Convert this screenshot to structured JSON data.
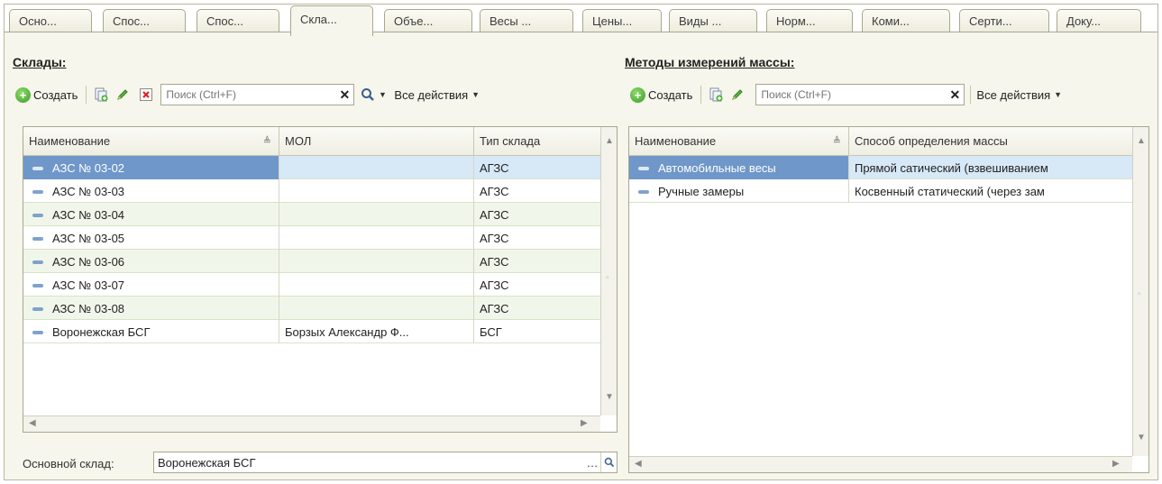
{
  "tabs": [
    {
      "label": "Осно..."
    },
    {
      "label": "Спос..."
    },
    {
      "label": "Спос..."
    },
    {
      "label": "Скла..."
    },
    {
      "label": "Объе..."
    },
    {
      "label": "Весы ..."
    },
    {
      "label": "Цены..."
    },
    {
      "label": "Виды ..."
    },
    {
      "label": "Норм..."
    },
    {
      "label": "Коми..."
    },
    {
      "label": "Серти..."
    },
    {
      "label": "Доку..."
    }
  ],
  "warehouses": {
    "title": "Склады:",
    "create_label": "Создать",
    "search_placeholder": "Поиск (Ctrl+F)",
    "all_actions_label": "Все действия",
    "columns": [
      "Наименование",
      "МОЛ",
      "Тип склада"
    ],
    "rows": [
      {
        "name": "АЗС № 03-02",
        "mol": "",
        "type": "АГЗС"
      },
      {
        "name": "АЗС № 03-03",
        "mol": "",
        "type": "АГЗС"
      },
      {
        "name": "АЗС № 03-04",
        "mol": "",
        "type": "АГЗС"
      },
      {
        "name": "АЗС № 03-05",
        "mol": "",
        "type": "АГЗС"
      },
      {
        "name": "АЗС № 03-06",
        "mol": "",
        "type": "АГЗС"
      },
      {
        "name": "АЗС № 03-07",
        "mol": "",
        "type": "АГЗС"
      },
      {
        "name": "АЗС № 03-08",
        "mol": "",
        "type": "АГЗС"
      },
      {
        "name": "Воронежская БСГ",
        "mol": "Борзых Александр Ф...",
        "type": "БСГ"
      }
    ],
    "main_label": "Основной склад:",
    "main_value": "Воронежская БСГ"
  },
  "methods": {
    "title": "Методы измерений массы:",
    "create_label": "Создать",
    "search_placeholder": "Поиск (Ctrl+F)",
    "all_actions_label": "Все действия",
    "columns": [
      "Наименование",
      "Способ определения массы"
    ],
    "rows": [
      {
        "name": "Автомобильные весы",
        "method": "Прямой сатический (взвешиванием"
      },
      {
        "name": "Ручные замеры",
        "method": "Косвенный статический (через зам"
      }
    ]
  },
  "colors": {
    "selection": "#6f97c9",
    "row_selected": "#d7e8f7",
    "row_alt": "#f1f6ea",
    "panel_bg": "#f6f6ec"
  }
}
